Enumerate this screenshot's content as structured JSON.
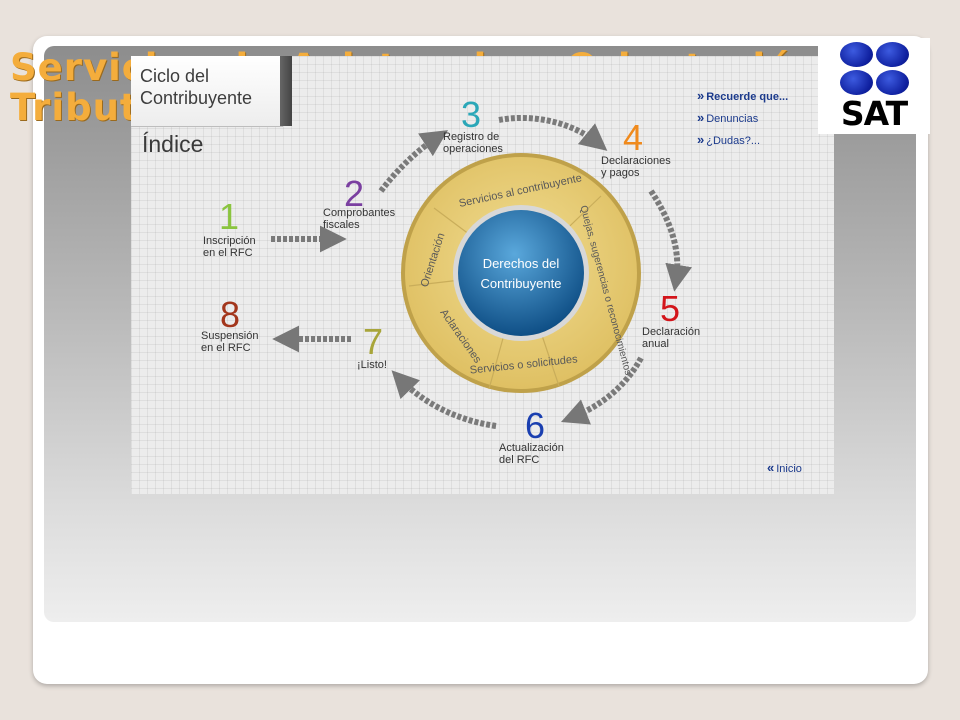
{
  "slide": {
    "title_line1": "Servicios de Asistencia y Orientación",
    "title_line2": "Tributaria"
  },
  "logo": {
    "text": "SAT"
  },
  "screenshot": {
    "brand_line1": "Ciclo del",
    "brand_line2": "Contribuyente",
    "index_title": "Índice",
    "links": [
      {
        "label": "Recuerde que..."
      },
      {
        "label": "Denuncias"
      },
      {
        "label": "¿Dudas?..."
      }
    ],
    "home_link": "Inicio",
    "steps": [
      {
        "num": "1",
        "line1": "Inscripción",
        "line2": "en el RFC",
        "color": "#8ac43f"
      },
      {
        "num": "2",
        "line1": "Comprobantes",
        "line2": "fiscales",
        "color": "#7a3fa0"
      },
      {
        "num": "3",
        "line1": "Registro de",
        "line2": "operaciones",
        "color": "#2aa7b8"
      },
      {
        "num": "4",
        "line1": "Declaraciones",
        "line2": "y pagos",
        "color": "#f08a1c"
      },
      {
        "num": "5",
        "line1": "Declaración",
        "line2": "anual",
        "color": "#d3151b"
      },
      {
        "num": "6",
        "line1": "Actualización",
        "line2": "del RFC",
        "color": "#1a3fb0"
      },
      {
        "num": "7",
        "line1": "¡Listo!",
        "line2": "",
        "color": "#a8a53a"
      },
      {
        "num": "8",
        "line1": "Suspensión",
        "line2": "en el RFC",
        "color": "#a3361c"
      }
    ],
    "ring": {
      "segments": [
        "Servicios al contribuyente",
        "Quejas, sugerencias o reconocimientos",
        "Servicios o solicitudes",
        "Aclaraciones",
        "Orientación"
      ],
      "center_line1": "Derechos del",
      "center_line2": "Contribuyente"
    }
  },
  "colors": {
    "title": "#f4ad3c",
    "link": "#1b3a8c",
    "ring_gold": "#e9cf73",
    "center_blue": "#1e6fa8"
  }
}
